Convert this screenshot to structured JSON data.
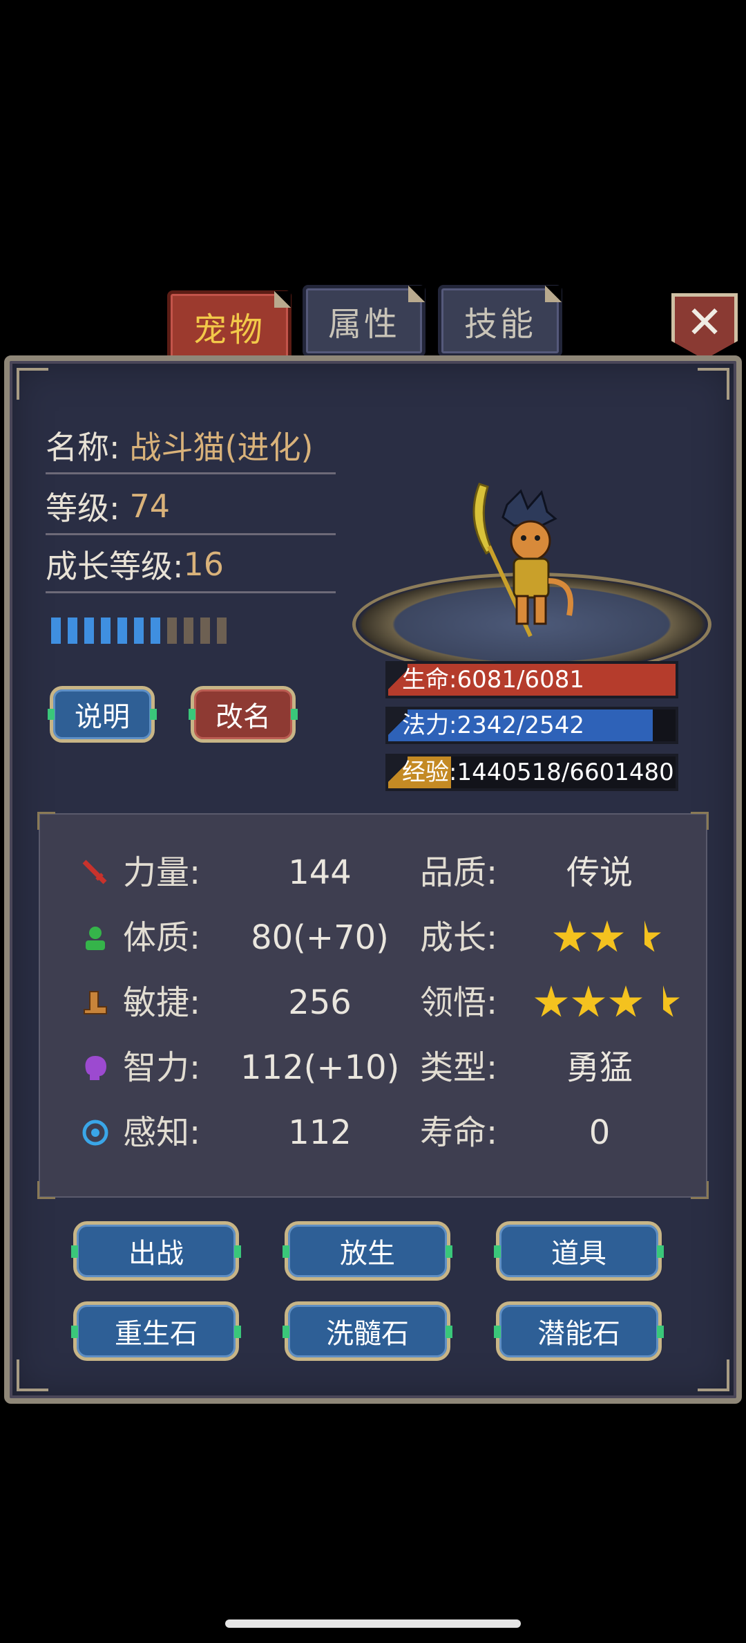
{
  "tabs": [
    {
      "label": "宠物",
      "active": true
    },
    {
      "label": "属性",
      "active": false
    },
    {
      "label": "技能",
      "active": false
    }
  ],
  "close_icon": "close-icon",
  "pet_info": {
    "name_label": "名称:",
    "name_value": "战斗猫(进化)",
    "level_label": "等级:",
    "level_value": "74",
    "growth_label": "成长等级:",
    "growth_value": "16",
    "growth_segments_filled": 7,
    "growth_segments_total": 11
  },
  "buttons": {
    "describe": "说明",
    "rename": "改名"
  },
  "bars": {
    "hp": {
      "text": "生命:6081/6081",
      "current": 6081,
      "max": 6081,
      "color": "#b53c2c"
    },
    "mp": {
      "text": "法力:2342/2542",
      "current": 2342,
      "max": 2542,
      "color": "#2e62b8"
    },
    "xp": {
      "text": "经验:1440518/6601480",
      "current": 1440518,
      "max": 6601480,
      "color": "#c48a24"
    }
  },
  "attributes": [
    {
      "icon": "sword-icon",
      "label": "力量:",
      "value": "144",
      "right_label": "品质:",
      "right_value": "传说"
    },
    {
      "icon": "person-icon",
      "label": "体质:",
      "value": "80(+70)",
      "right_label": "成长:",
      "right_stars": 2.5
    },
    {
      "icon": "boot-icon",
      "label": "敏捷:",
      "value": "256",
      "right_label": "领悟:",
      "right_stars": 3.5
    },
    {
      "icon": "brain-icon",
      "label": "智力:",
      "value": "112(+10)",
      "right_label": "类型:",
      "right_value": "勇猛"
    },
    {
      "icon": "target-icon",
      "label": "感知:",
      "value": "112",
      "right_label": "寿命:",
      "right_value": "0"
    }
  ],
  "actions": [
    "出战",
    "放生",
    "道具",
    "重生石",
    "洗髓石",
    "潜能石"
  ]
}
